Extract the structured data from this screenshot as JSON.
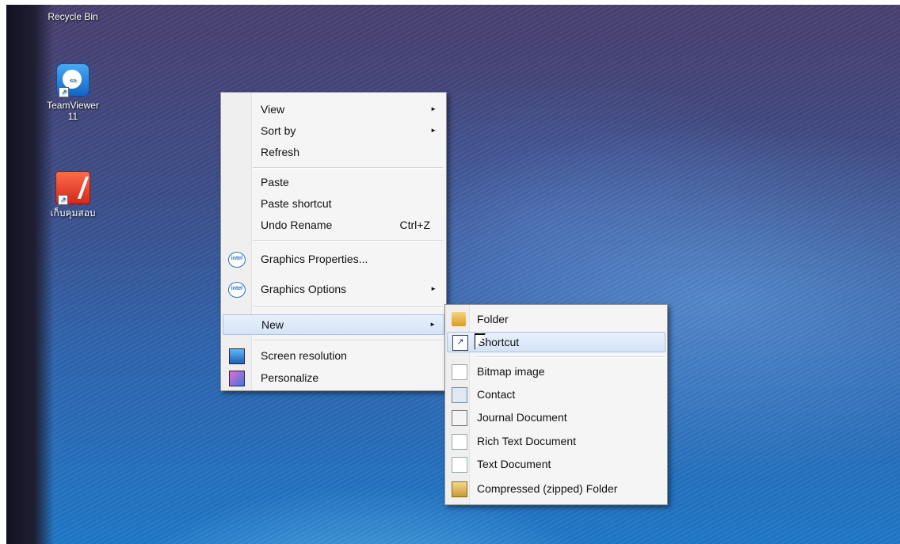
{
  "desktop": {
    "icons": [
      {
        "name": "Recycle Bin"
      },
      {
        "name": "TeamViewer 11"
      },
      {
        "name": "เก็บคุมสอบ"
      }
    ]
  },
  "context_menu": {
    "items": [
      {
        "label": "View",
        "has_submenu": true
      },
      {
        "label": "Sort by",
        "has_submenu": true
      },
      {
        "label": "Refresh"
      },
      {
        "label": "Paste"
      },
      {
        "label": "Paste shortcut"
      },
      {
        "label": "Undo Rename",
        "accelerator": "Ctrl+Z"
      },
      {
        "label": "Graphics Properties...",
        "icon": "intel-icon"
      },
      {
        "label": "Graphics Options",
        "icon": "intel-icon",
        "has_submenu": true
      },
      {
        "label": "New",
        "has_submenu": true,
        "highlighted": true
      },
      {
        "label": "Screen resolution",
        "icon": "monitor-icon"
      },
      {
        "label": "Personalize",
        "icon": "personalize-icon"
      }
    ]
  },
  "new_submenu": {
    "items": [
      {
        "label": "Folder",
        "icon": "folder-icon"
      },
      {
        "label": "Shortcut",
        "icon": "shortcut-icon",
        "highlighted": true
      },
      {
        "label": "Bitmap image",
        "icon": "bitmap-icon"
      },
      {
        "label": "Contact",
        "icon": "contact-icon"
      },
      {
        "label": "Journal Document",
        "icon": "journal-icon"
      },
      {
        "label": "Rich Text Document",
        "icon": "rtf-icon"
      },
      {
        "label": "Text Document",
        "icon": "text-doc-icon"
      },
      {
        "label": "Compressed (zipped) Folder",
        "icon": "zip-folder-icon"
      }
    ]
  },
  "glyphs": {
    "intel": "intel",
    "submenu_arrow": "►",
    "shortcut_arrow": "↗"
  }
}
